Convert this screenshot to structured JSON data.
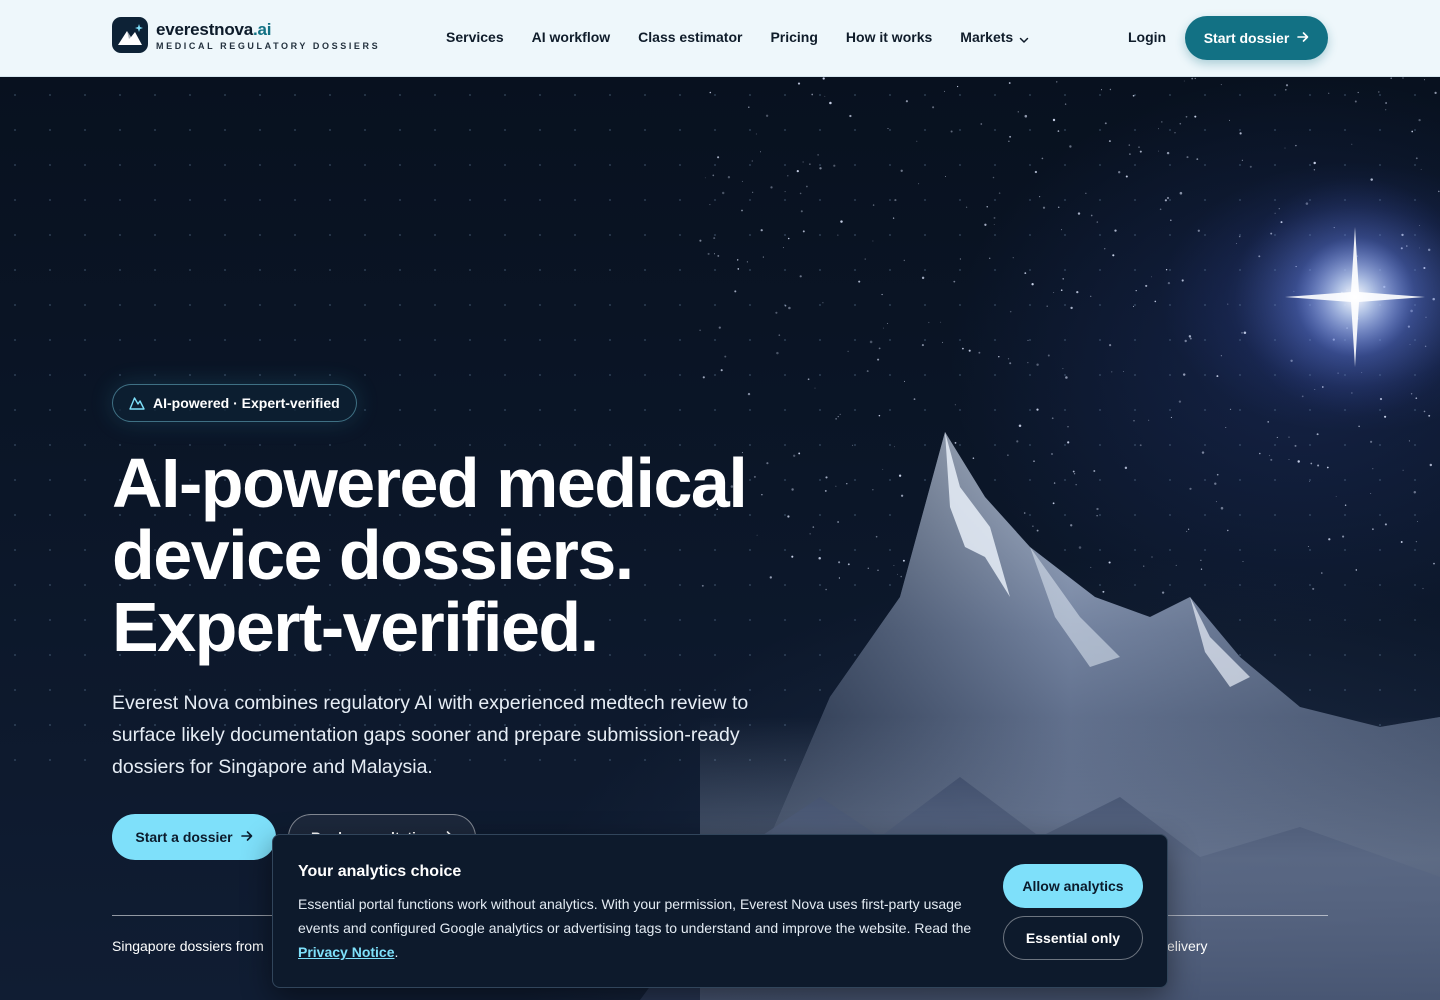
{
  "nav": {
    "brand_name": "everestnova",
    "brand_tld": ".ai",
    "brand_sub": "MEDICAL REGULATORY DOSSIERS",
    "items": [
      {
        "label": "Services"
      },
      {
        "label": "AI workflow"
      },
      {
        "label": "Class estimator"
      },
      {
        "label": "Pricing"
      },
      {
        "label": "How it works"
      },
      {
        "label": "Markets",
        "icon": "chevron-down-icon"
      }
    ],
    "login": "Login",
    "cta": "Start dossier",
    "cta_icon": "arrow-right-icon"
  },
  "hero": {
    "badge": "AI-powered · Expert-verified",
    "badge_icon": "mountain-icon",
    "headline": [
      "AI-powered medical",
      "device dossiers.",
      "Expert-verified."
    ],
    "lede": "Everest Nova combines regulatory AI with experienced medtech review to surface likely documentation gaps sooner and prepare submission-ready dossiers for Singapore and Malaysia.",
    "cta_primary": "Start a dossier",
    "cta_secondary": "Book consultation",
    "stat_left": "Singapore dossiers from",
    "stat_right": "elivery"
  },
  "consent": {
    "title": "Your analytics choice",
    "body": "Essential portal functions work without analytics. With your permission, Everest Nova uses first-party usage events and configured Google analytics or advertising tags to understand and improve the website. Read the ",
    "link": "Privacy Notice",
    "body_end": ".",
    "allow": "Allow analytics",
    "essential": "Essential only"
  },
  "colors": {
    "nav_bg": "#eef7fb",
    "accent": "#127184",
    "accent_light": "#7ee0fa",
    "hero_bg": "#0a1424",
    "panel_bg": "#0d1a2c"
  }
}
